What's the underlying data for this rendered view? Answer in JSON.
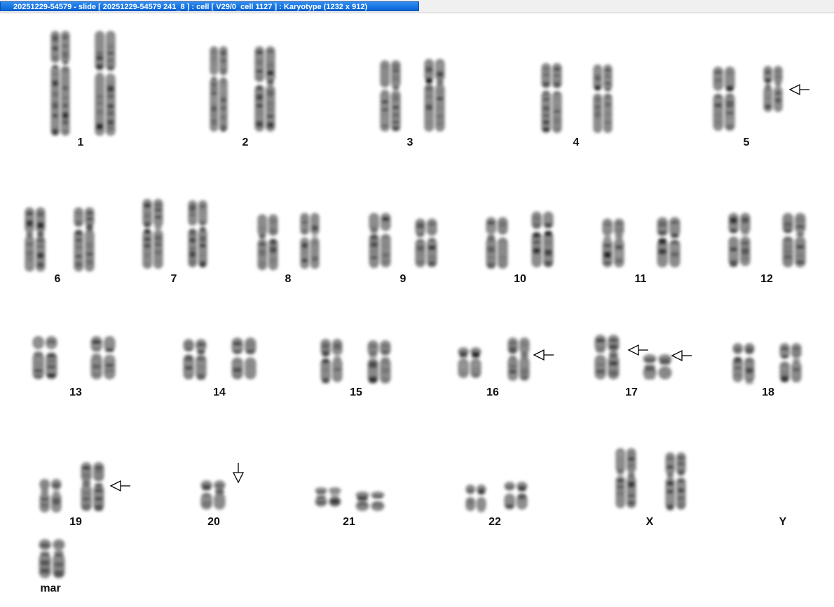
{
  "window": {
    "title": "20251229-54579 - slide [ 20251229-54579 241_8 ] : cell [ V29/0_cell 1127 ] : Karyotype  (1232 x 912)"
  },
  "karyotype": {
    "labels": [
      "1",
      "2",
      "3",
      "4",
      "5",
      "6",
      "7",
      "8",
      "9",
      "10",
      "11",
      "12",
      "13",
      "14",
      "15",
      "16",
      "17",
      "18",
      "19",
      "20",
      "21",
      "22",
      "X",
      "Y",
      "mar"
    ],
    "annotated": [
      "5",
      "16",
      "17",
      "19",
      "20"
    ]
  },
  "colors": {
    "title_bar": "#0a64d6",
    "title_text": "#ffffff",
    "label": "#111111",
    "chromosome": "#333333"
  },
  "icons": [
    "arrow-left-icon",
    "arrow-down-icon"
  ]
}
